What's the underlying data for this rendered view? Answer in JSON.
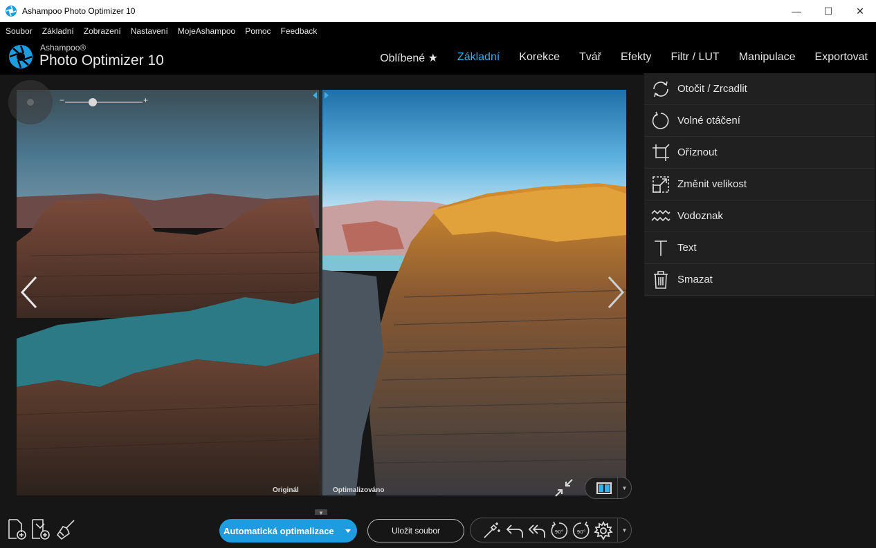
{
  "window": {
    "title": "Ashampoo Photo Optimizer 10",
    "controls": [
      "—",
      "☐",
      "✕"
    ]
  },
  "menu": [
    "Soubor",
    "Základní",
    "Zobrazení",
    "Nastavení",
    "MojeAshampoo",
    "Pomoc",
    "Feedback"
  ],
  "brand": {
    "small": "Ashampoo®",
    "big": "Photo Optimizer 10"
  },
  "tabs": [
    {
      "label": "Oblíbené ★",
      "active": false
    },
    {
      "label": "Základní",
      "active": true
    },
    {
      "label": "Korekce",
      "active": false
    },
    {
      "label": "Tvář",
      "active": false
    },
    {
      "label": "Efekty",
      "active": false
    },
    {
      "label": "Filtr / LUT",
      "active": false
    },
    {
      "label": "Manipulace",
      "active": false
    },
    {
      "label": "Exportovat",
      "active": false
    }
  ],
  "zoom": {
    "minus": "−",
    "plus": "+",
    "level": 0.36
  },
  "viewer": {
    "original_caption": "Originál",
    "optimized_caption": "Optimalizováno"
  },
  "panel_items": [
    {
      "label": "Otočit / Zrcadlit",
      "icon": "rotate-mirror-icon"
    },
    {
      "label": "Volné otáčení",
      "icon": "free-rotate-icon"
    },
    {
      "label": "Oříznout",
      "icon": "crop-icon"
    },
    {
      "label": "Změnit velikost",
      "icon": "resize-icon"
    },
    {
      "label": "Vodoznak",
      "icon": "watermark-icon"
    },
    {
      "label": "Text",
      "icon": "text-icon"
    },
    {
      "label": "Smazat",
      "icon": "trash-icon"
    }
  ],
  "bottom": {
    "auto_optimize": "Automatická optimalizace",
    "save_file": "Uložit soubor",
    "rotate_left_label": "90°",
    "rotate_right_label": "90°"
  },
  "colors": {
    "accent": "#3aaee6",
    "button_blue": "#1d9ce0",
    "panel_bg": "#202020",
    "header_bg": "#000000"
  }
}
